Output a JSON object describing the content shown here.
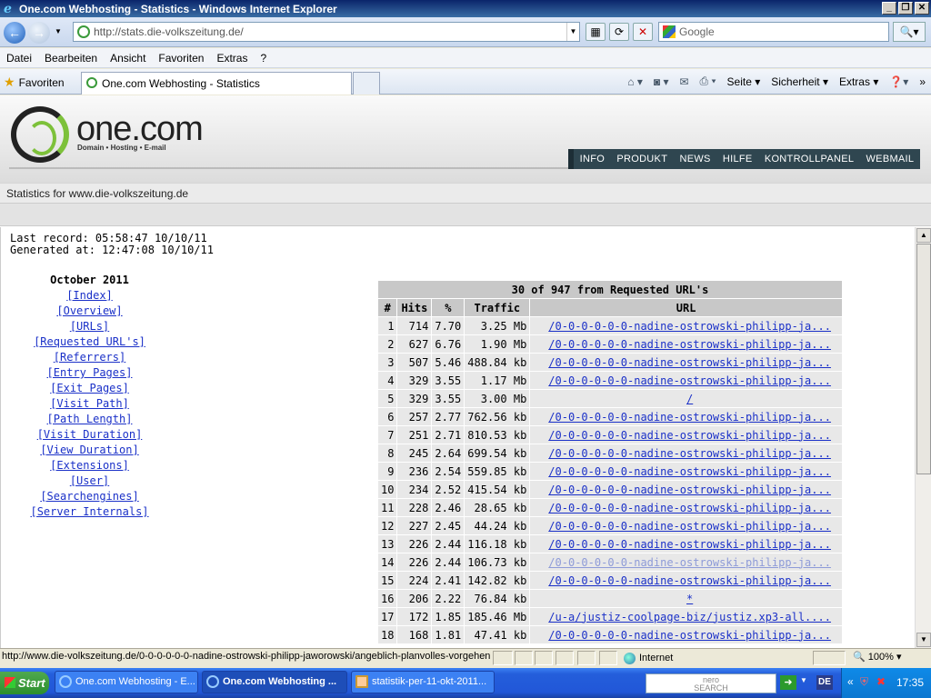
{
  "window": {
    "title": "One.com Webhosting - Statistics - Windows Internet Explorer"
  },
  "address_bar": {
    "url": "http://stats.die-volkszeitung.de/",
    "search_placeholder": "Google"
  },
  "menu": [
    "Datei",
    "Bearbeiten",
    "Ansicht",
    "Favoriten",
    "Extras",
    "?"
  ],
  "tabbar": {
    "favorites_label": "Favoriten",
    "tab_title": "One.com Webhosting - Statistics",
    "commands": [
      "Seite",
      "Sicherheit",
      "Extras"
    ]
  },
  "site": {
    "logo_text": "one.com",
    "logo_tagline": "Domain • Hosting • E-mail",
    "nav": [
      "INFO",
      "PRODUKT",
      "NEWS",
      "HILFE",
      "KONTROLLPANEL",
      "WEBMAIL"
    ],
    "stats_for": "Statistics for www.die-volkszeitung.de",
    "last_record": "Last record: 05:58:47 10/10/11",
    "generated_at": "Generated at: 12:47:08 10/10/11",
    "month": "October 2011",
    "links": [
      "[Index]",
      "[Overview]",
      "[URLs]",
      "[Requested URL's]",
      "[Referrers]",
      "[Entry Pages]",
      "[Exit Pages]",
      "[Visit Path]",
      "[Path Length]",
      "[Visit Duration]",
      "[View Duration]",
      "[Extensions]",
      "[User]",
      "[Searchengines]",
      "[Server Internals]"
    ]
  },
  "table": {
    "caption": "30 of 947 from Requested URL's",
    "headers": [
      "#",
      "Hits",
      "%",
      "Traffic",
      "URL"
    ],
    "rows": [
      {
        "n": "1",
        "hits": "714",
        "pct": "7.70",
        "traffic": "3.25 Mb",
        "url": "/0-0-0-0-0-0-nadine-ostrowski-philipp-ja...",
        "visited": false
      },
      {
        "n": "2",
        "hits": "627",
        "pct": "6.76",
        "traffic": "1.90 Mb",
        "url": "/0-0-0-0-0-0-nadine-ostrowski-philipp-ja...",
        "visited": false
      },
      {
        "n": "3",
        "hits": "507",
        "pct": "5.46",
        "traffic": "488.84 kb",
        "url": "/0-0-0-0-0-0-nadine-ostrowski-philipp-ja...",
        "visited": false
      },
      {
        "n": "4",
        "hits": "329",
        "pct": "3.55",
        "traffic": "1.17 Mb",
        "url": "/0-0-0-0-0-0-nadine-ostrowski-philipp-ja...",
        "visited": false
      },
      {
        "n": "5",
        "hits": "329",
        "pct": "3.55",
        "traffic": "3.00 Mb",
        "url": "/",
        "visited": false
      },
      {
        "n": "6",
        "hits": "257",
        "pct": "2.77",
        "traffic": "762.56 kb",
        "url": "/0-0-0-0-0-0-nadine-ostrowski-philipp-ja...",
        "visited": false
      },
      {
        "n": "7",
        "hits": "251",
        "pct": "2.71",
        "traffic": "810.53 kb",
        "url": "/0-0-0-0-0-0-nadine-ostrowski-philipp-ja...",
        "visited": false
      },
      {
        "n": "8",
        "hits": "245",
        "pct": "2.64",
        "traffic": "699.54 kb",
        "url": "/0-0-0-0-0-0-nadine-ostrowski-philipp-ja...",
        "visited": false
      },
      {
        "n": "9",
        "hits": "236",
        "pct": "2.54",
        "traffic": "559.85 kb",
        "url": "/0-0-0-0-0-0-nadine-ostrowski-philipp-ja...",
        "visited": false
      },
      {
        "n": "10",
        "hits": "234",
        "pct": "2.52",
        "traffic": "415.54 kb",
        "url": "/0-0-0-0-0-0-nadine-ostrowski-philipp-ja...",
        "visited": false
      },
      {
        "n": "11",
        "hits": "228",
        "pct": "2.46",
        "traffic": "28.65 kb",
        "url": "/0-0-0-0-0-0-nadine-ostrowski-philipp-ja...",
        "visited": false
      },
      {
        "n": "12",
        "hits": "227",
        "pct": "2.45",
        "traffic": "44.24 kb",
        "url": "/0-0-0-0-0-0-nadine-ostrowski-philipp-ja...",
        "visited": false
      },
      {
        "n": "13",
        "hits": "226",
        "pct": "2.44",
        "traffic": "116.18 kb",
        "url": "/0-0-0-0-0-0-nadine-ostrowski-philipp-ja...",
        "visited": false
      },
      {
        "n": "14",
        "hits": "226",
        "pct": "2.44",
        "traffic": "106.73 kb",
        "url": "/0-0-0-0-0-0-nadine-ostrowski-philipp-ja...",
        "visited": true
      },
      {
        "n": "15",
        "hits": "224",
        "pct": "2.41",
        "traffic": "142.82 kb",
        "url": "/0-0-0-0-0-0-nadine-ostrowski-philipp-ja...",
        "visited": false
      },
      {
        "n": "16",
        "hits": "206",
        "pct": "2.22",
        "traffic": "76.84 kb",
        "url": "*",
        "visited": false
      },
      {
        "n": "17",
        "hits": "172",
        "pct": "1.85",
        "traffic": "185.46 Mb",
        "url": "/u-a/justiz-coolpage-biz/justiz.xp3-all....",
        "visited": false
      },
      {
        "n": "18",
        "hits": "168",
        "pct": "1.81",
        "traffic": "47.41 kb",
        "url": "/0-0-0-0-0-0-nadine-ostrowski-philipp-ja...",
        "visited": false
      }
    ]
  },
  "statusbar": {
    "text": "http://www.die-volkszeitung.de/0-0-0-0-0-0-nadine-ostrowski-philipp-jaworowski/angeblich-planvolles-vorgehen",
    "zone": "Internet",
    "zoom": "100%"
  },
  "taskbar": {
    "start": "Start",
    "tasks": [
      "One.com Webhosting - E...",
      "One.com Webhosting ...",
      "statistik-per-11-okt-2011..."
    ],
    "nero": "nero\nSEARCH",
    "lang": "DE",
    "clock": "17:35"
  }
}
